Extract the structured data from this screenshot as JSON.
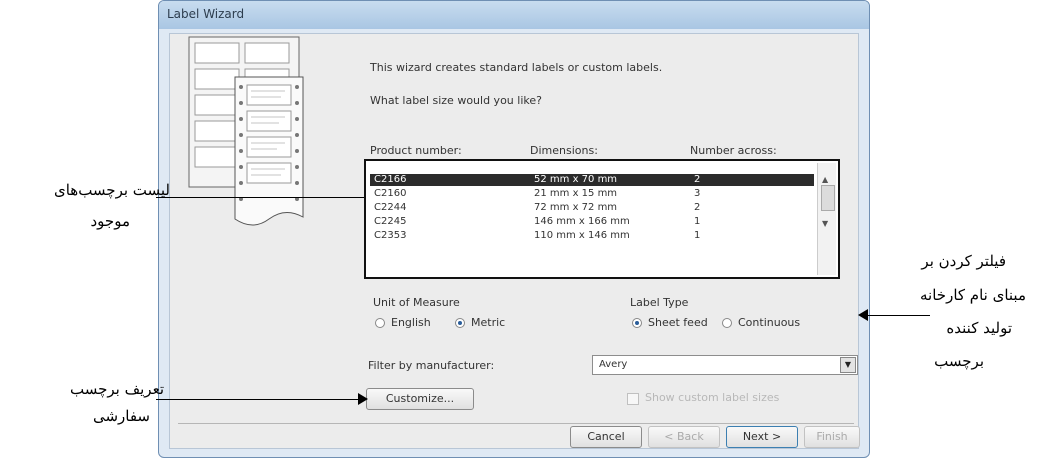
{
  "dialog": {
    "title": "Label Wizard",
    "intro": "This wizard creates standard labels or custom labels.",
    "question": "What label size would you like?",
    "columns": [
      "Product number:",
      "Dimensions:",
      "Number across:"
    ],
    "rows": [
      {
        "product": "C2166",
        "dims": "52 mm x 70 mm",
        "across": "2",
        "selected": true
      },
      {
        "product": "C2160",
        "dims": "21 mm x 15 mm",
        "across": "3",
        "selected": false
      },
      {
        "product": "C2244",
        "dims": "72 mm x 72 mm",
        "across": "2",
        "selected": false
      },
      {
        "product": "C2245",
        "dims": "146 mm x 166 mm",
        "across": "1",
        "selected": false
      },
      {
        "product": "C2353",
        "dims": "110 mm x 146 mm",
        "across": "1",
        "selected": false
      }
    ],
    "unit_label": "Unit of Measure",
    "unit_options": [
      "English",
      "Metric"
    ],
    "unit_selected": "Metric",
    "labeltype_label": "Label Type",
    "labeltype_options": [
      "Sheet feed",
      "Continuous"
    ],
    "labeltype_selected": "Sheet feed",
    "filter_label": "Filter by manufacturer:",
    "filter_value": "Avery",
    "customize_button": "Customize...",
    "show_custom_label": "Show custom label sizes",
    "buttons": {
      "cancel": "Cancel",
      "back": "< Back",
      "next": "Next >",
      "finish": "Finish"
    }
  },
  "annotations": {
    "list": [
      "لیست برچسب‌های",
      "موجود"
    ],
    "filter": [
      "فیلتر کردن بر",
      "مبنای نام کارخانه",
      "تولید کننده",
      "برچسب"
    ],
    "custom": [
      "تعریف برچسب",
      "سفارشی"
    ]
  }
}
